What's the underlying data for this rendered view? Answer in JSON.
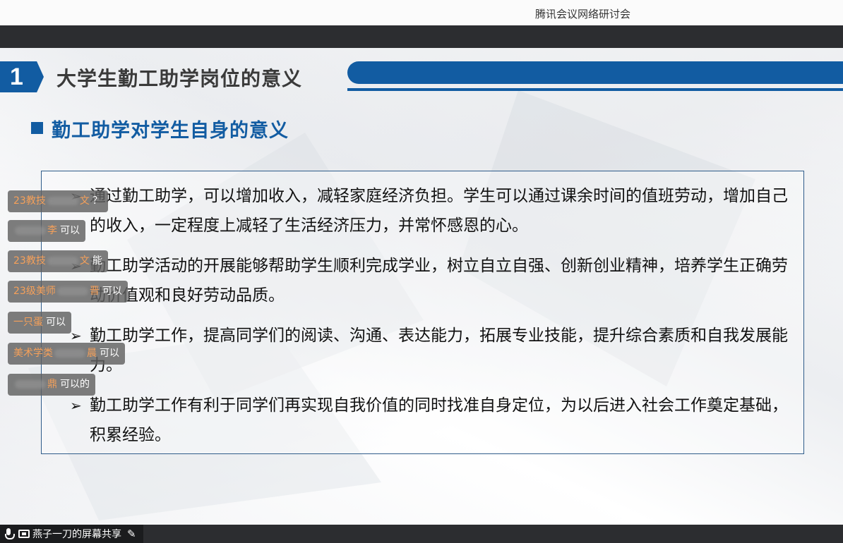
{
  "window": {
    "title": "腾讯会议网络研讨会"
  },
  "slide": {
    "section_number": "1",
    "section_title": "大学生勤工助学岗位的意义",
    "subheading": "勤工助学对学生自身的意义",
    "bullet_symbol": "➢",
    "bullets": [
      {
        "text": "通过勤工助学，可以增加收入，减轻家庭经济负担。学生可以通过课余时间的值班劳动，增加自己的收入，一定程度上减轻了生活经济压力，并常怀感恩的心。"
      },
      {
        "text": "勤工助学活动的开展能够帮助学生顺利完成学业，树立自立自强、创新创业精神，培养学生正确劳动价值观和良好劳动品质。"
      },
      {
        "text": "勤工助学工作，提高同学们的阅读、沟通、表达能力，拓展专业技能，提升综合素质和自我发展能力。"
      },
      {
        "text": "勤工助学工作有利于同学们再实现自我价值的同时找准自身定位，为以后进入社会工作奠定基础，积累经验。"
      }
    ]
  },
  "chat_messages": [
    {
      "name_prefix": "23教技",
      "name_suffix": "文",
      "message": "？"
    },
    {
      "name_prefix": "",
      "name_suffix": "李",
      "message": "可以"
    },
    {
      "name_prefix": "23教技",
      "name_suffix": "文",
      "message": "能"
    },
    {
      "name_prefix": "23级美师",
      "name_suffix": "晋",
      "message": "可以"
    },
    {
      "name_prefix": "一只蛋",
      "name_suffix": "",
      "message": "可以"
    },
    {
      "name_prefix": "美术学类",
      "name_suffix": "晨",
      "message": "可以"
    },
    {
      "name_prefix": "",
      "name_suffix": "鼎",
      "message": "可以的"
    }
  ],
  "bottom_bar": {
    "share_label": "燕子一刀的屏幕共享",
    "icons": [
      "microphone-icon",
      "screen-share-icon",
      "pencil-icon"
    ]
  },
  "colors": {
    "accent": "#125ca2",
    "chat_name": "#f5a05a",
    "bar_dark": "#2c2d30"
  }
}
